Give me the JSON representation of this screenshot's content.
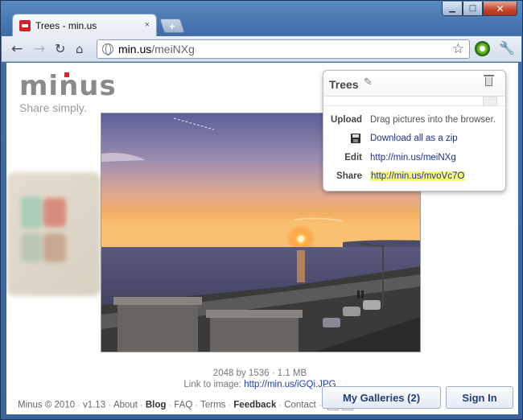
{
  "window": {
    "minimize_glyph": "▁",
    "maximize_glyph": "□",
    "close_glyph": "✕"
  },
  "tab": {
    "title": "Trees - min.us",
    "close_glyph": "×",
    "new_tab_glyph": "+"
  },
  "toolbar": {
    "back_glyph": "←",
    "forward_glyph": "→",
    "reload_glyph": "↻",
    "home_glyph": "⌂",
    "url_host": "min.us",
    "url_path": "/meiNXg",
    "star_glyph": "☆",
    "wrench_glyph": "🔧"
  },
  "logo": {
    "text": "minus",
    "tagline": "Share simply."
  },
  "card": {
    "title": "Trees",
    "pencil_glyph": "✎",
    "rows": {
      "upload": {
        "label": "Upload",
        "value": "Drag pictures into the browser."
      },
      "download": {
        "value": "Download all as a zip"
      },
      "edit": {
        "label": "Edit",
        "value": "http://min.us/meiNXg"
      },
      "share": {
        "label": "Share",
        "value": "http://min.us/mvoVc7O"
      }
    }
  },
  "image_meta": {
    "dimensions": "2048 by 1536",
    "dot": "·",
    "size": "1.1 MB",
    "link_label": "Link to image:",
    "link_url": "http://min.us/iGQi.JPG"
  },
  "footer": {
    "copyright": "Minus © 2010",
    "version": "v1.13",
    "about": "About",
    "blog": "Blog",
    "faq": "FAQ",
    "terms": "Terms",
    "feedback": "Feedback",
    "contact": "Contact",
    "sep": "·"
  },
  "buttons": {
    "galleries": "My Galleries (2)",
    "signin": "Sign In"
  },
  "colors": {
    "link": "#1a2f9a",
    "highlight": "#fbf97a",
    "brand_red": "#d42a2a"
  }
}
